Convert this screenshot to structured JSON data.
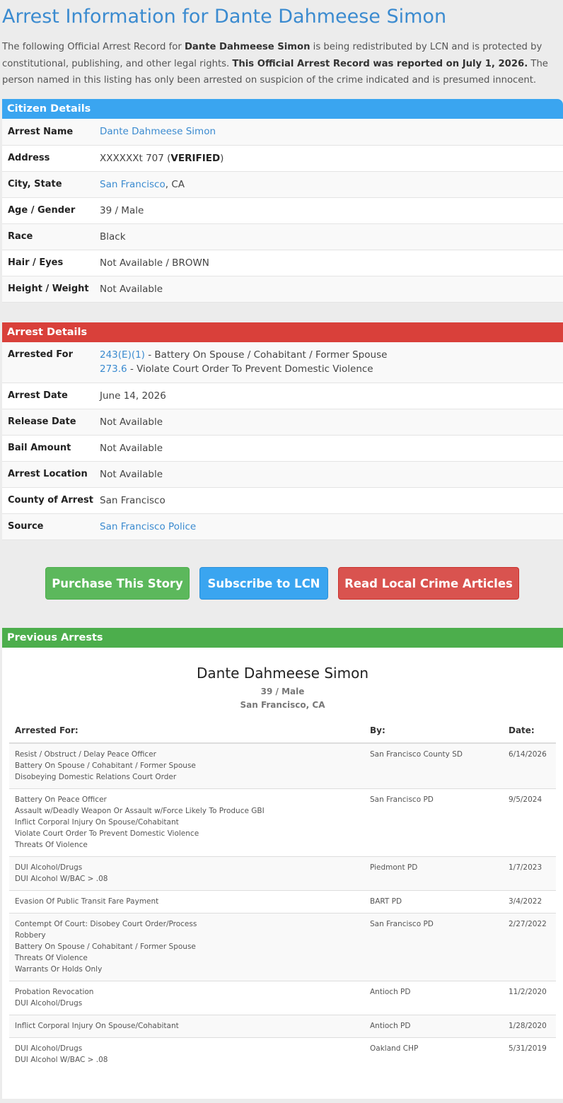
{
  "title": "Arrest Information for Dante Dahmeese Simon",
  "intro": {
    "p1": "The following Official Arrest Record for ",
    "name": "Dante Dahmeese Simon",
    "p2": " is being redistributed by LCN and is protected by constitutional, publishing, and other legal rights. ",
    "reported": "This Official Arrest Record was reported on July 1, 2026.",
    "p3": " The person named in this listing has only been arrested on suspicion of the crime indicated and is presumed innocent."
  },
  "citizen": {
    "heading": "Citizen Details",
    "arrest_name_label": "Arrest Name",
    "arrest_name": "Dante Dahmeese Simon",
    "address_label": "Address",
    "address": "XXXXXXt 707 (",
    "verified": "VERIFIED",
    "address_close": ")",
    "city_label": "City, State",
    "city": "San Francisco",
    "state": ", CA",
    "age_label": "Age / Gender",
    "age": "39 / Male",
    "race_label": "Race",
    "race": "Black",
    "hair_label": "Hair / Eyes",
    "hair": "Not Available / BROWN",
    "height_label": "Height / Weight",
    "height": "Not Available"
  },
  "arrest": {
    "heading": "Arrest Details",
    "for_label": "Arrested For",
    "charges": [
      {
        "code": "243(E)(1)",
        "desc": " - Battery On Spouse / Cohabitant / Former Spouse"
      },
      {
        "code": "273.6",
        "desc": " - Violate Court Order To Prevent Domestic Violence"
      }
    ],
    "date_label": "Arrest Date",
    "date": "June 14, 2026",
    "release_label": "Release Date",
    "release": "Not Available",
    "bail_label": "Bail Amount",
    "bail": "Not Available",
    "location_label": "Arrest Location",
    "location": "Not Available",
    "county_label": "County of Arrest",
    "county": "San Francisco",
    "source_label": "Source",
    "source": "San Francisco Police"
  },
  "buttons": {
    "purchase": "Purchase This Story",
    "subscribe": "Subscribe to LCN",
    "read": "Read Local Crime Articles"
  },
  "previous": {
    "heading": "Previous Arrests",
    "name": "Dante Dahmeese Simon",
    "age": "39 / Male",
    "city": "San Francisco, CA",
    "col_for": "Arrested For:",
    "col_by": "By:",
    "col_date": "Date:",
    "rows": [
      {
        "charges": [
          "Resist / Obstruct / Delay Peace Officer",
          "Battery On Spouse / Cohabitant / Former Spouse",
          "Disobeying Domestic Relations Court Order"
        ],
        "by": "San Francisco County SD",
        "date": "6/14/2026"
      },
      {
        "charges": [
          "Battery On Peace Officer",
          "Assault w/Deadly Weapon Or Assault w/Force Likely To Produce GBI",
          "Inflict Corporal Injury On Spouse/Cohabitant",
          "Violate Court Order To Prevent Domestic Violence",
          "Threats Of Violence"
        ],
        "by": "San Francisco PD",
        "date": "9/5/2024"
      },
      {
        "charges": [
          "DUI Alcohol/Drugs",
          "DUI Alcohol W/BAC > .08"
        ],
        "by": "Piedmont PD",
        "date": "1/7/2023"
      },
      {
        "charges": [
          "Evasion Of Public Transit Fare Payment"
        ],
        "by": "BART PD",
        "date": "3/4/2022"
      },
      {
        "charges": [
          "Contempt Of Court: Disobey Court Order/Process",
          "Robbery",
          "Battery On Spouse / Cohabitant / Former Spouse",
          "Threats Of Violence",
          "Warrants Or Holds Only"
        ],
        "by": "San Francisco PD",
        "date": "2/27/2022"
      },
      {
        "charges": [
          "Probation Revocation",
          "DUI Alcohol/Drugs"
        ],
        "by": "Antioch PD",
        "date": "11/2/2020"
      },
      {
        "charges": [
          "Inflict Corporal Injury On Spouse/Cohabitant"
        ],
        "by": "Antioch PD",
        "date": "1/28/2020"
      },
      {
        "charges": [
          "DUI Alcohol/Drugs",
          "DUI Alcohol W/BAC > .08"
        ],
        "by": "Oakland CHP",
        "date": "5/31/2019"
      }
    ]
  }
}
